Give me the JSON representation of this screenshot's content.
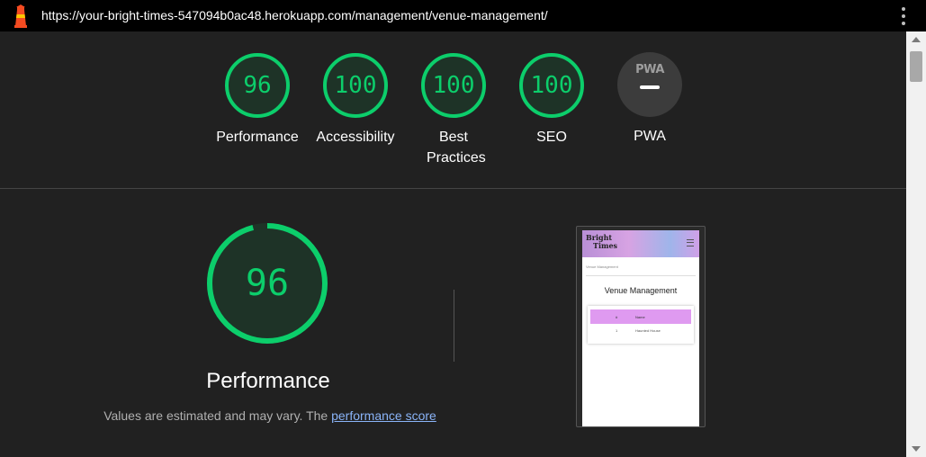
{
  "browser": {
    "url": "https://your-bright-times-547094b0ac48.herokuapp.com/management/venue-management/"
  },
  "colors": {
    "pass_green": "#0cce6b",
    "background": "#212121"
  },
  "categories": [
    {
      "label": "Performance",
      "score": "96",
      "value": 96
    },
    {
      "label": "Accessibility",
      "score": "100",
      "value": 100
    },
    {
      "label": "Best Practices",
      "score": "100",
      "value": 100
    },
    {
      "label": "SEO",
      "score": "100",
      "value": 100
    }
  ],
  "pwa": {
    "label": "PWA",
    "badge_text": "PWA"
  },
  "main": {
    "score": "96",
    "value": 96,
    "title": "Performance",
    "note_prefix": "Values are estimated and may vary. The ",
    "note_link": "performance score"
  },
  "screenshot": {
    "brand_line1": "Bright",
    "brand_line2": "Times",
    "breadcrumb": "Venue Management",
    "title": "Venue Management",
    "table_headers": [
      "#",
      "Name"
    ],
    "rows": [
      [
        "1",
        "Haunted House"
      ]
    ]
  }
}
